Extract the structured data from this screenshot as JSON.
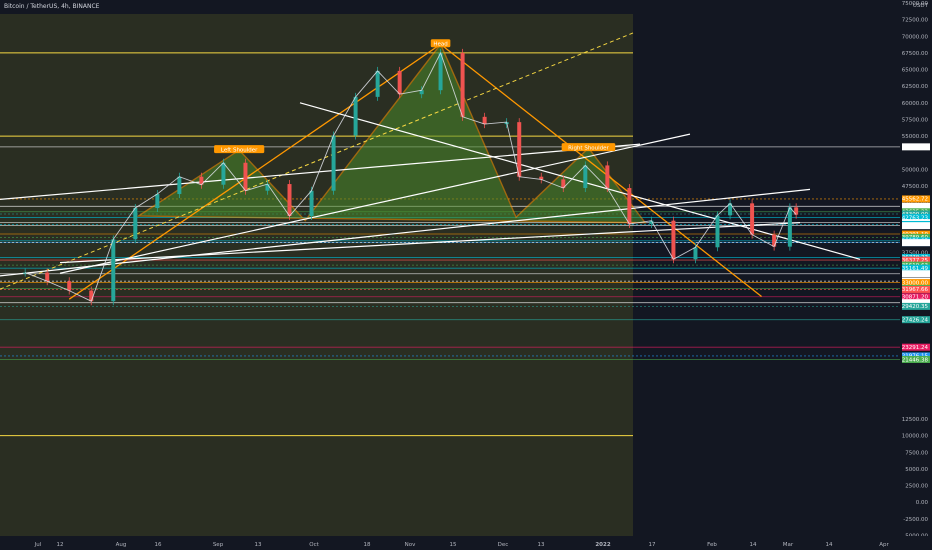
{
  "header": {
    "title": "Bitcoin / TetherUS, 4h, BINANCE"
  },
  "axis": {
    "currency_label": "USDT"
  },
  "chart_data": {
    "type": "line",
    "title": "Bitcoin / TetherUS, 4h, BINANCE",
    "xlabel": "",
    "ylabel": "USDT",
    "ylim": [
      -5000,
      75000
    ],
    "x_ticks": [
      "Jul",
      "12",
      "Aug",
      "16",
      "Sep",
      "13",
      "Oct",
      "18",
      "Nov",
      "15",
      "Dec",
      "13",
      "2022",
      "17",
      "Feb",
      "14",
      "Mar",
      "14",
      "Apr"
    ],
    "y_ticks": [
      75000,
      72500,
      70000,
      67500,
      65000,
      62500,
      60000,
      57500,
      55000,
      50000,
      47500,
      45000,
      42500,
      40000,
      37500,
      35000,
      12500,
      10000,
      7500,
      5000,
      2500,
      0,
      -2500,
      -5000
    ],
    "series": [
      {
        "x": [
          "2021-07-01",
          "2021-07-08",
          "2021-07-15",
          "2021-07-22",
          "2021-07-29",
          "2021-08-05",
          "2021-08-12",
          "2021-08-19",
          "2021-08-26",
          "2021-09-02",
          "2021-09-09",
          "2021-09-16",
          "2021-09-23",
          "2021-09-30",
          "2021-10-07",
          "2021-10-14",
          "2021-10-21",
          "2021-10-28",
          "2021-11-04",
          "2021-11-10",
          "2021-11-17",
          "2021-11-24",
          "2021-12-01",
          "2021-12-05",
          "2021-12-12",
          "2021-12-19",
          "2021-12-26",
          "2022-01-02",
          "2022-01-09",
          "2022-01-16",
          "2022-01-23",
          "2022-01-30",
          "2022-02-06",
          "2022-02-10",
          "2022-02-17",
          "2022-02-24",
          "2022-03-01",
          "2022-03-03"
        ],
        "values": [
          34500,
          33200,
          31800,
          30200,
          39500,
          44200,
          46300,
          48900,
          47700,
          51000,
          46800,
          47800,
          43000,
          46800,
          55100,
          60900,
          64800,
          61300,
          61900,
          67500,
          57900,
          56800,
          57100,
          48900,
          48500,
          47200,
          50600,
          47200,
          41800,
          42300,
          36500,
          38300,
          43100,
          44900,
          40200,
          38400,
          44300,
          43200
        ]
      }
    ],
    "price_labels": [
      {
        "text": "53390.67",
        "value": 53390,
        "color": "#ffffff"
      },
      {
        "text": "45562.72",
        "value": 45562,
        "color": "#ff9800"
      },
      {
        "text": "44456.37",
        "value": 44456,
        "color": "#ffffff"
      },
      {
        "text": "43635.22",
        "value": 43635,
        "color": "#4caf50"
      },
      {
        "text": "43300.00",
        "value": 43300,
        "color": "#26a69a"
      },
      {
        "text": "42763.23",
        "value": 42763,
        "color": "#00bcd4"
      },
      {
        "text": "42003.74",
        "value": 42003,
        "color": "#ffffff"
      },
      {
        "text": "41730.00",
        "value": 41730,
        "color": "#00bcd4"
      },
      {
        "text": "41549.38",
        "value": 41549,
        "color": "#ffffff"
      },
      {
        "text": "40291.10",
        "value": 40291,
        "color": "#ff9800"
      },
      {
        "text": "39789.60",
        "value": 39789,
        "color": "#4caf50"
      },
      {
        "text": "39271.05",
        "value": 39271,
        "color": "#00bcd4"
      },
      {
        "text": "39000.00",
        "value": 39000,
        "color": "#2196f3"
      },
      {
        "text": "38997.94",
        "value": 38997,
        "color": "#ffffff"
      },
      {
        "text": "36778.23",
        "value": 36778,
        "color": "#00bcd4"
      },
      {
        "text": "36377.25",
        "value": 36377,
        "color": "#ff5252"
      },
      {
        "text": "35619.63",
        "value": 35619,
        "color": "#4caf50"
      },
      {
        "text": "35161.49",
        "value": 35161,
        "color": "#00bcd4"
      },
      {
        "text": "34326.19",
        "value": 34326,
        "color": "#ffffff"
      },
      {
        "text": "33209.90",
        "value": 33209,
        "color": "#ffffff"
      },
      {
        "text": "33000.00",
        "value": 33000,
        "color": "#ff9800"
      },
      {
        "text": "32123.56",
        "value": 32123,
        "color": "#4caf50"
      },
      {
        "text": "31967.66",
        "value": 31967,
        "color": "#ff5252"
      },
      {
        "text": "30871.20",
        "value": 30871,
        "color": "#e91e63"
      },
      {
        "text": "29977.82",
        "value": 29977,
        "color": "#ffffff"
      },
      {
        "text": "29420.35",
        "value": 29420,
        "color": "#26a69a"
      },
      {
        "text": "27426.24",
        "value": 27426,
        "color": "#26a69a"
      },
      {
        "text": "23291.24",
        "value": 23291,
        "color": "#e91e63"
      },
      {
        "text": "21976.15",
        "value": 21976,
        "color": "#2196f3"
      },
      {
        "text": "21446.38",
        "value": 21446,
        "color": "#4caf50"
      }
    ],
    "pattern_labels": [
      {
        "text": "Left Shoulder",
        "x": "2021-09-07",
        "value": 52900
      },
      {
        "text": "Head",
        "x": "2021-11-10",
        "value": 68800
      },
      {
        "text": "Right Shoulder",
        "x": "2021-12-27",
        "value": 53200
      }
    ],
    "colors": {
      "background": "#131722",
      "history_zone": "#2a2e22",
      "pattern_fill": "#4a8a2a",
      "neckline": "#ff9800",
      "candle_up": "#26a69a",
      "candle_down": "#ef5350"
    },
    "grid": false,
    "legend": "none"
  }
}
